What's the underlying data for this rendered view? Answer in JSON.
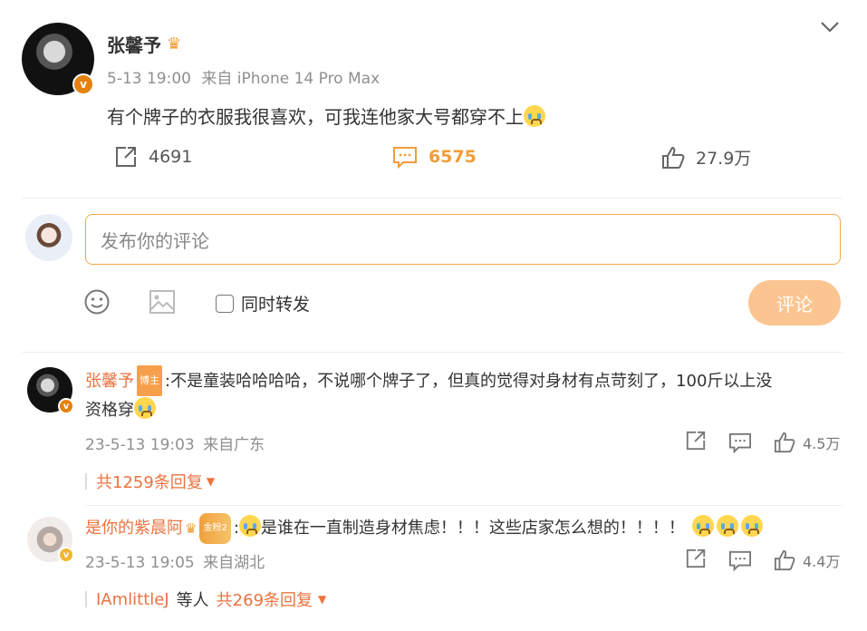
{
  "post": {
    "author": "张馨予",
    "time": "5-13 19:00",
    "source": "来自 iPhone 14 Pro Max",
    "text": "有个牌子的衣服我很喜欢，可我连他家大号都穿不上",
    "stats": {
      "repost": "4691",
      "comment": "6575",
      "like": "27.9万"
    }
  },
  "composer": {
    "placeholder": "发布你的评论",
    "also_repost": "同时转发",
    "submit": "评论"
  },
  "comments": [
    {
      "name": "张馨予",
      "badge": "博主",
      "text": ":不是童装哈哈哈哈，不说哪个牌子了，但真的觉得对身材有点苛刻了，100斤以上没",
      "text2": "资格穿",
      "time": "23-5-13 19:03",
      "location": "来自广东",
      "likes": "4.5万",
      "replies": "共1259条回复"
    },
    {
      "name": "是你的紫晨阿",
      "badge": "金粉2",
      "text": "是谁在一直制造身材焦虑！！！这些店家怎么想的！！！！",
      "time": "23-5-13 19:05",
      "location": "来自湖北",
      "likes": "4.4万",
      "reply_user": "IAmlittleJ",
      "reply_mid": "等人",
      "replies": "共269条回复"
    }
  ],
  "colors": {
    "accent": "#eb7340",
    "orange": "#f39c3a",
    "button": "#fbc591"
  }
}
